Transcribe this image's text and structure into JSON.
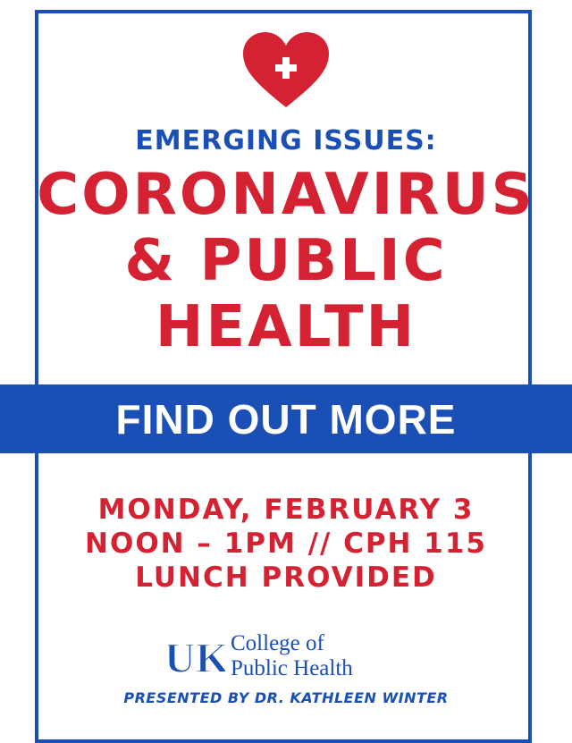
{
  "header": {
    "subtitle": "EMERGING ISSUES:",
    "title_lines": [
      "CORONAVIRUS",
      "& PUBLIC",
      "HEALTH"
    ]
  },
  "cta": {
    "label": "FIND OUT MORE"
  },
  "event": {
    "date": "MONDAY, FEBRUARY 3",
    "time_place": "NOON – 1PM // CPH 115",
    "note": "LUNCH PROVIDED"
  },
  "footer": {
    "logo_mark": "UK",
    "college_line1": "College of",
    "college_line2": "Public Health",
    "presenter": "PRESENTED BY DR. KATHLEEN WINTER"
  },
  "icons": {
    "top": "heart-plus-icon"
  },
  "colors": {
    "blue": "#1a4fb5",
    "red": "#d42232",
    "background": "#ffffff"
  }
}
